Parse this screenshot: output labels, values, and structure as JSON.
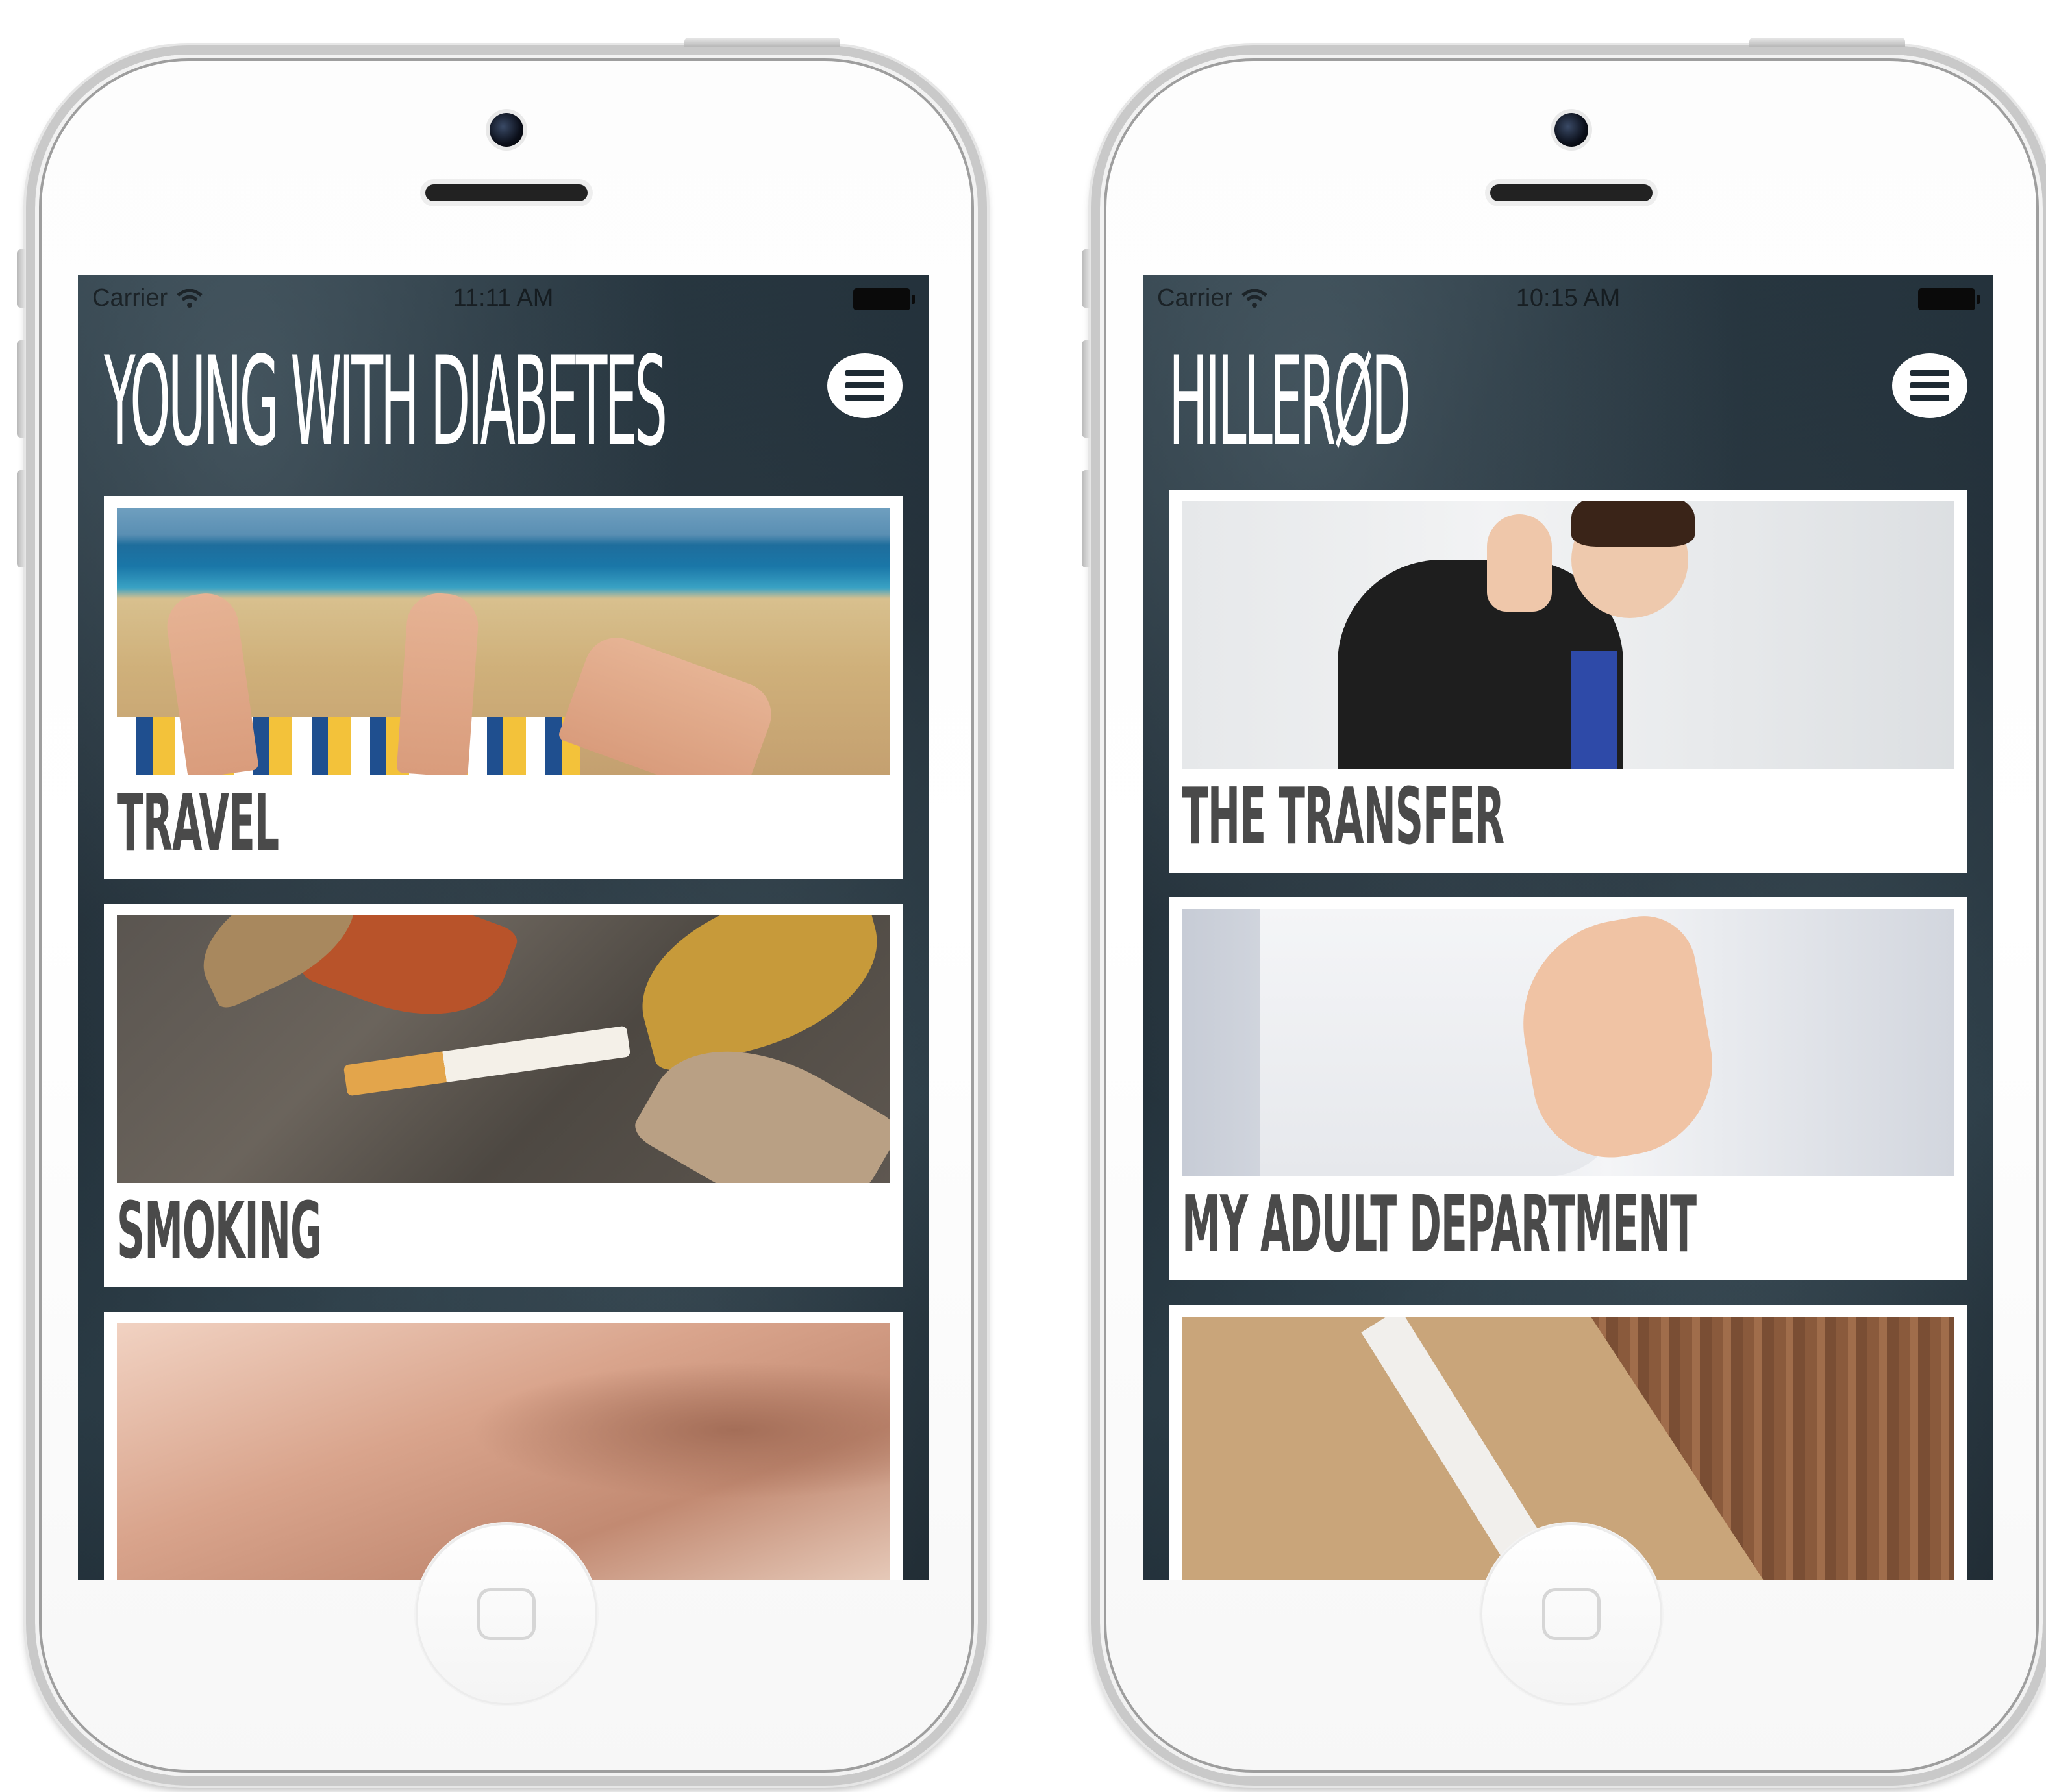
{
  "phones": [
    {
      "status": {
        "carrier": "Carrier",
        "time": "11:11 AM"
      },
      "header": {
        "title": "YOUNG WITH DIABETES",
        "menu_icon": "hamburger-icon"
      },
      "cards": [
        {
          "label": "TRAVEL",
          "image": "beach-feet-photo"
        },
        {
          "label": "SMOKING",
          "image": "cigarette-leaves-photo"
        },
        {
          "label": "",
          "image": "couple-embrace-photo"
        }
      ]
    },
    {
      "status": {
        "carrier": "Carrier",
        "time": "10:15 AM"
      },
      "header": {
        "title": "HILLERØD",
        "menu_icon": "hamburger-icon"
      },
      "cards": [
        {
          "label": "THE TRANSFER",
          "image": "waving-teen-photo"
        },
        {
          "label": "MY ADULT DEPARTMENT",
          "image": "handshake-photo"
        },
        {
          "label": "",
          "image": "envelope-photo"
        }
      ]
    }
  ],
  "colors": {
    "screen_bg": "#1f2c35",
    "card_bg": "#ffffff",
    "caption_text": "#4a4a4a",
    "title_text": "#ffffff"
  }
}
